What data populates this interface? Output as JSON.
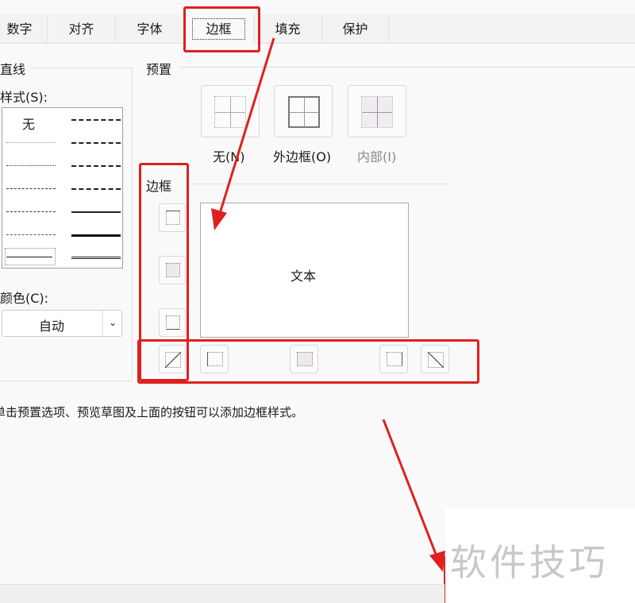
{
  "tabs": [
    "数字",
    "对齐",
    "字体",
    "边框",
    "填充",
    "保护"
  ],
  "active_tab": "边框",
  "line_group": {
    "title": "直线",
    "style_label": "样式(S):",
    "none_label": "无",
    "color_label": "颜色(C):",
    "color_value": "自动"
  },
  "preset_group": {
    "title": "预置",
    "none": "无(N)",
    "outline": "外边框(O)",
    "inside": "内部(I)"
  },
  "border_group": {
    "title": "边框",
    "preview_text": "文本"
  },
  "hint": "单击预置选项、预览草图及上面的按钮可以添加边框样式。",
  "watermark": "软件技巧",
  "colors": {
    "highlight": "#e02020"
  }
}
